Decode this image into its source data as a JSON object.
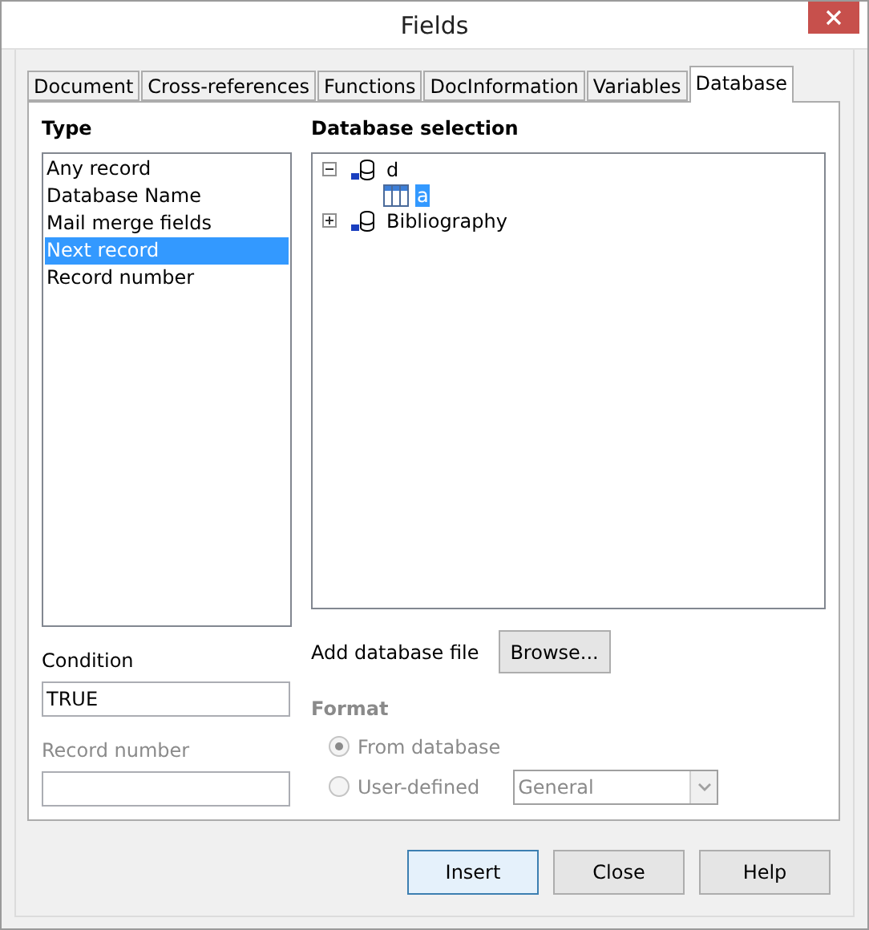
{
  "window": {
    "title": "Fields"
  },
  "tabs": [
    {
      "label": "Document",
      "selected": false
    },
    {
      "label": "Cross-references",
      "selected": false
    },
    {
      "label": "Functions",
      "selected": false
    },
    {
      "label": "DocInformation",
      "selected": false
    },
    {
      "label": "Variables",
      "selected": false
    },
    {
      "label": "Database",
      "selected": true
    }
  ],
  "type": {
    "heading": "Type",
    "items": [
      {
        "label": "Any record",
        "selected": false
      },
      {
        "label": "Database Name",
        "selected": false
      },
      {
        "label": "Mail merge fields",
        "selected": false
      },
      {
        "label": "Next record",
        "selected": true
      },
      {
        "label": "Record number",
        "selected": false
      }
    ]
  },
  "condition": {
    "label": "Condition",
    "value": "TRUE"
  },
  "record_number": {
    "label": "Record number",
    "disabled": true
  },
  "database_selection": {
    "heading": "Database selection",
    "tree": [
      {
        "label": "d",
        "kind": "database",
        "expanded": true,
        "selected": false,
        "children": [
          {
            "label": "a",
            "kind": "table",
            "selected": true
          }
        ]
      },
      {
        "label": "Bibliography",
        "kind": "database",
        "expanded": false,
        "selected": false
      }
    ]
  },
  "add_database_file": {
    "label": "Add database file",
    "button": "Browse..."
  },
  "format": {
    "heading": "Format",
    "disabled": true,
    "options": [
      {
        "label": "From database",
        "selected": true
      },
      {
        "label": "User-defined",
        "selected": false
      }
    ],
    "dropdown": "General"
  },
  "buttons": [
    {
      "label": "Insert",
      "default": true
    },
    {
      "label": "Close",
      "default": false
    },
    {
      "label": "Help",
      "default": false
    }
  ]
}
